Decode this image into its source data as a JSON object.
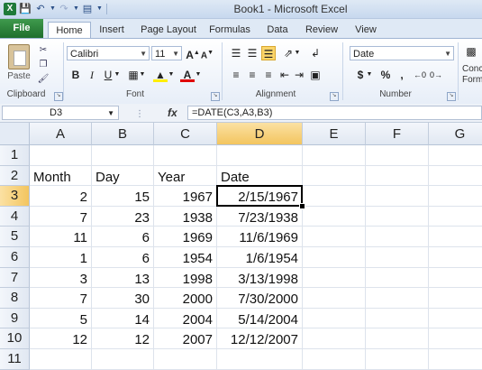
{
  "window": {
    "title": "Book1 - Microsoft Excel"
  },
  "qat": {
    "save_icon": "save-icon",
    "undo_icon": "undo-icon",
    "redo_icon": "redo-icon"
  },
  "ribbon_tabs": [
    {
      "label": "File"
    },
    {
      "label": "Home"
    },
    {
      "label": "Insert"
    },
    {
      "label": "Page Layout"
    },
    {
      "label": "Formulas"
    },
    {
      "label": "Data"
    },
    {
      "label": "Review"
    },
    {
      "label": "View"
    }
  ],
  "ribbon": {
    "clipboard": {
      "paste_label": "Paste",
      "group_label": "Clipboard"
    },
    "font": {
      "font_name": "Calibri",
      "font_size": "11",
      "bold": "B",
      "italic": "I",
      "underline": "U",
      "group_label": "Font"
    },
    "alignment": {
      "group_label": "Alignment"
    },
    "number": {
      "format": "Date",
      "currency": "$",
      "percent": "%",
      "comma": ",",
      "group_label": "Number"
    },
    "styles": {
      "partial_label_1": "Conc",
      "partial_label_2": "Form"
    }
  },
  "formula_bar": {
    "name_box": "D3",
    "fx": "fx",
    "formula": "=DATE(C3,A3,B3)"
  },
  "sheet": {
    "columns": [
      "A",
      "B",
      "C",
      "D",
      "E",
      "F",
      "G"
    ],
    "selected_column": "D",
    "rows": [
      {
        "num": "1",
        "cells": [
          "",
          "",
          "",
          ""
        ]
      },
      {
        "num": "2",
        "cells": [
          "Month",
          "Day",
          "Year",
          "Date"
        ]
      },
      {
        "num": "3",
        "cells": [
          "2",
          "15",
          "1967",
          "2/15/1967"
        ]
      },
      {
        "num": "4",
        "cells": [
          "7",
          "23",
          "1938",
          "7/23/1938"
        ]
      },
      {
        "num": "5",
        "cells": [
          "11",
          "6",
          "1969",
          "11/6/1969"
        ]
      },
      {
        "num": "6",
        "cells": [
          "1",
          "6",
          "1954",
          "1/6/1954"
        ]
      },
      {
        "num": "7",
        "cells": [
          "3",
          "13",
          "1998",
          "3/13/1998"
        ]
      },
      {
        "num": "8",
        "cells": [
          "7",
          "30",
          "2000",
          "7/30/2000"
        ]
      },
      {
        "num": "9",
        "cells": [
          "5",
          "14",
          "2004",
          "5/14/2004"
        ]
      },
      {
        "num": "10",
        "cells": [
          "12",
          "12",
          "2007",
          "12/12/2007"
        ]
      },
      {
        "num": "11",
        "cells": [
          "",
          "",
          "",
          ""
        ]
      }
    ],
    "active_cell": "D3"
  }
}
